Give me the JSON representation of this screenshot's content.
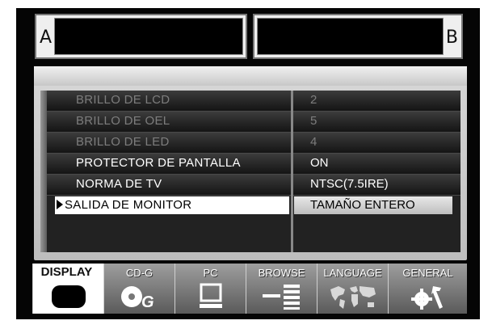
{
  "slots": {
    "a_label": "A",
    "b_label": "B"
  },
  "menu": {
    "rows": [
      {
        "label": "BRILLO DE LCD",
        "value": "2",
        "state": "dim"
      },
      {
        "label": "BRILLO DE OEL",
        "value": "5",
        "state": "dim"
      },
      {
        "label": "BRILLO DE LED",
        "value": "4",
        "state": "dim"
      },
      {
        "label": "PROTECTOR DE PANTALLA",
        "value": "ON",
        "state": "on"
      },
      {
        "label": "NORMA DE TV",
        "value": "NTSC(7.5IRE)",
        "state": "on"
      },
      {
        "label": "SALIDA DE MONITOR",
        "value": "TAMAÑO ENTERO",
        "state": "selected"
      }
    ]
  },
  "tabs": [
    {
      "label": "DISPLAY",
      "icon": "monitor-icon",
      "active": true
    },
    {
      "label": "CD-G",
      "icon": "cdg-icon",
      "active": false
    },
    {
      "label": "PC",
      "icon": "pc-icon",
      "active": false
    },
    {
      "label": "BROWSE",
      "icon": "browse-icon",
      "active": false
    },
    {
      "label": "LANGUAGE",
      "icon": "world-map-icon",
      "active": false
    },
    {
      "label": "GENERAL",
      "icon": "tools-icon",
      "active": false
    }
  ]
}
